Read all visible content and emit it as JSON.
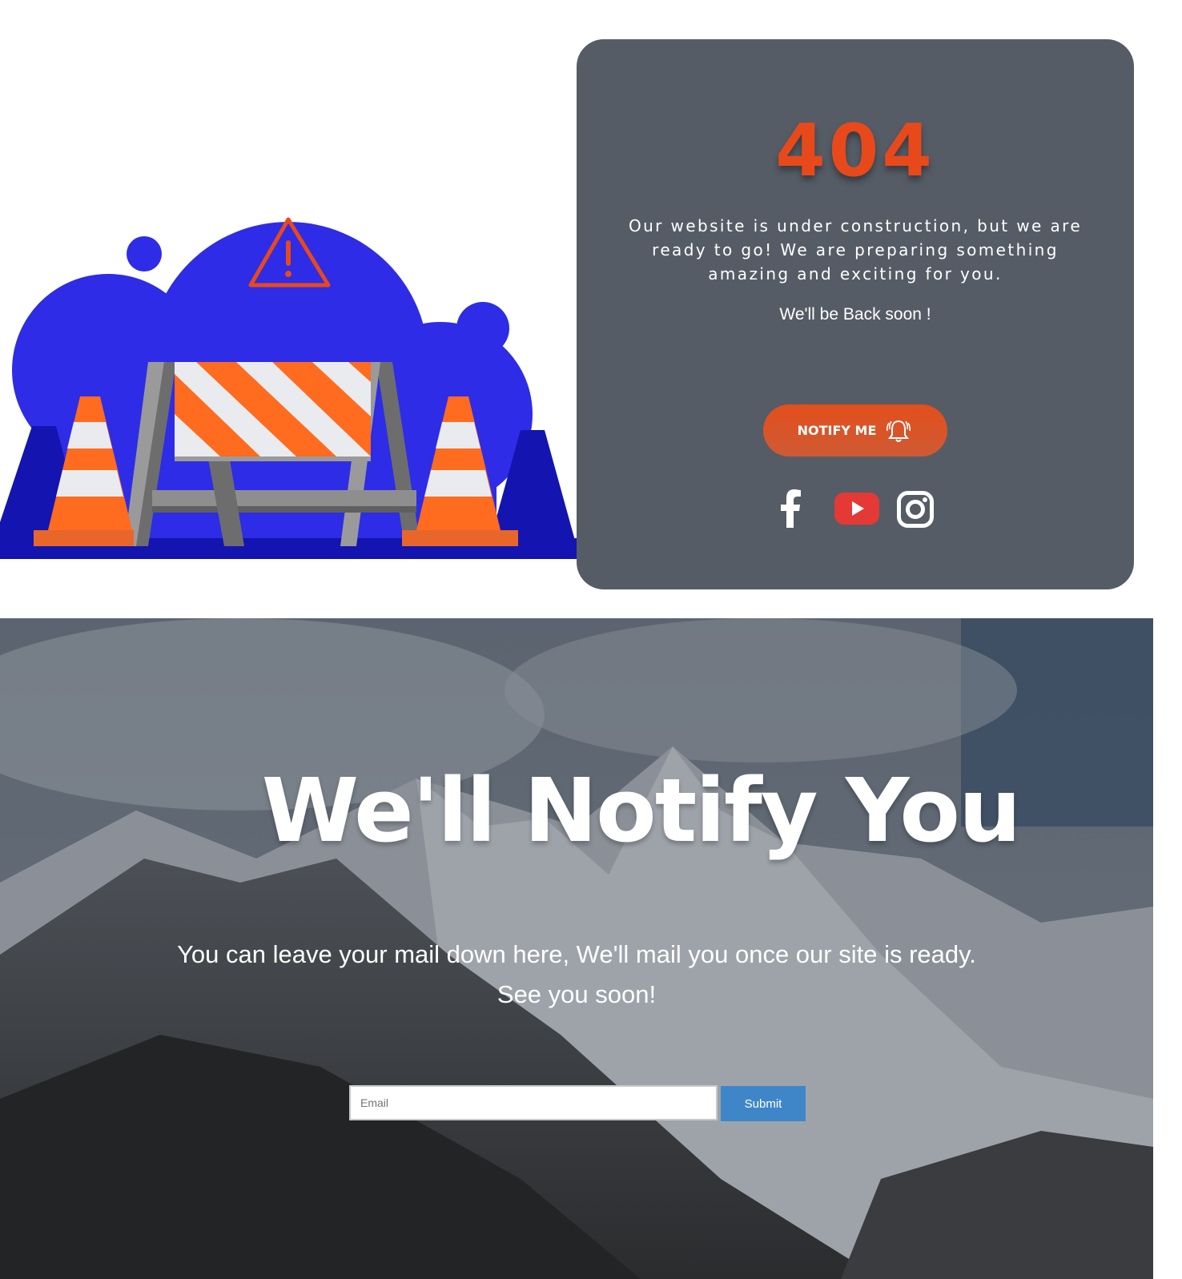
{
  "error": {
    "code": "404",
    "description": "Our website is under construction, but we are ready to go! We are preparing something amazing and exciting for you.",
    "back_soon": "We'll be Back soon !",
    "notify_label": "NOTIFY ME",
    "accent_color": "#e8491b"
  },
  "social": [
    {
      "name": "facebook-icon"
    },
    {
      "name": "youtube-icon"
    },
    {
      "name": "instagram-icon"
    }
  ],
  "notify_section": {
    "headline": "We'll Notify You",
    "subtext": "You can leave your mail down here, We'll mail you once our site is ready. See you soon!",
    "email_placeholder": "Email",
    "submit_label": "Submit"
  }
}
